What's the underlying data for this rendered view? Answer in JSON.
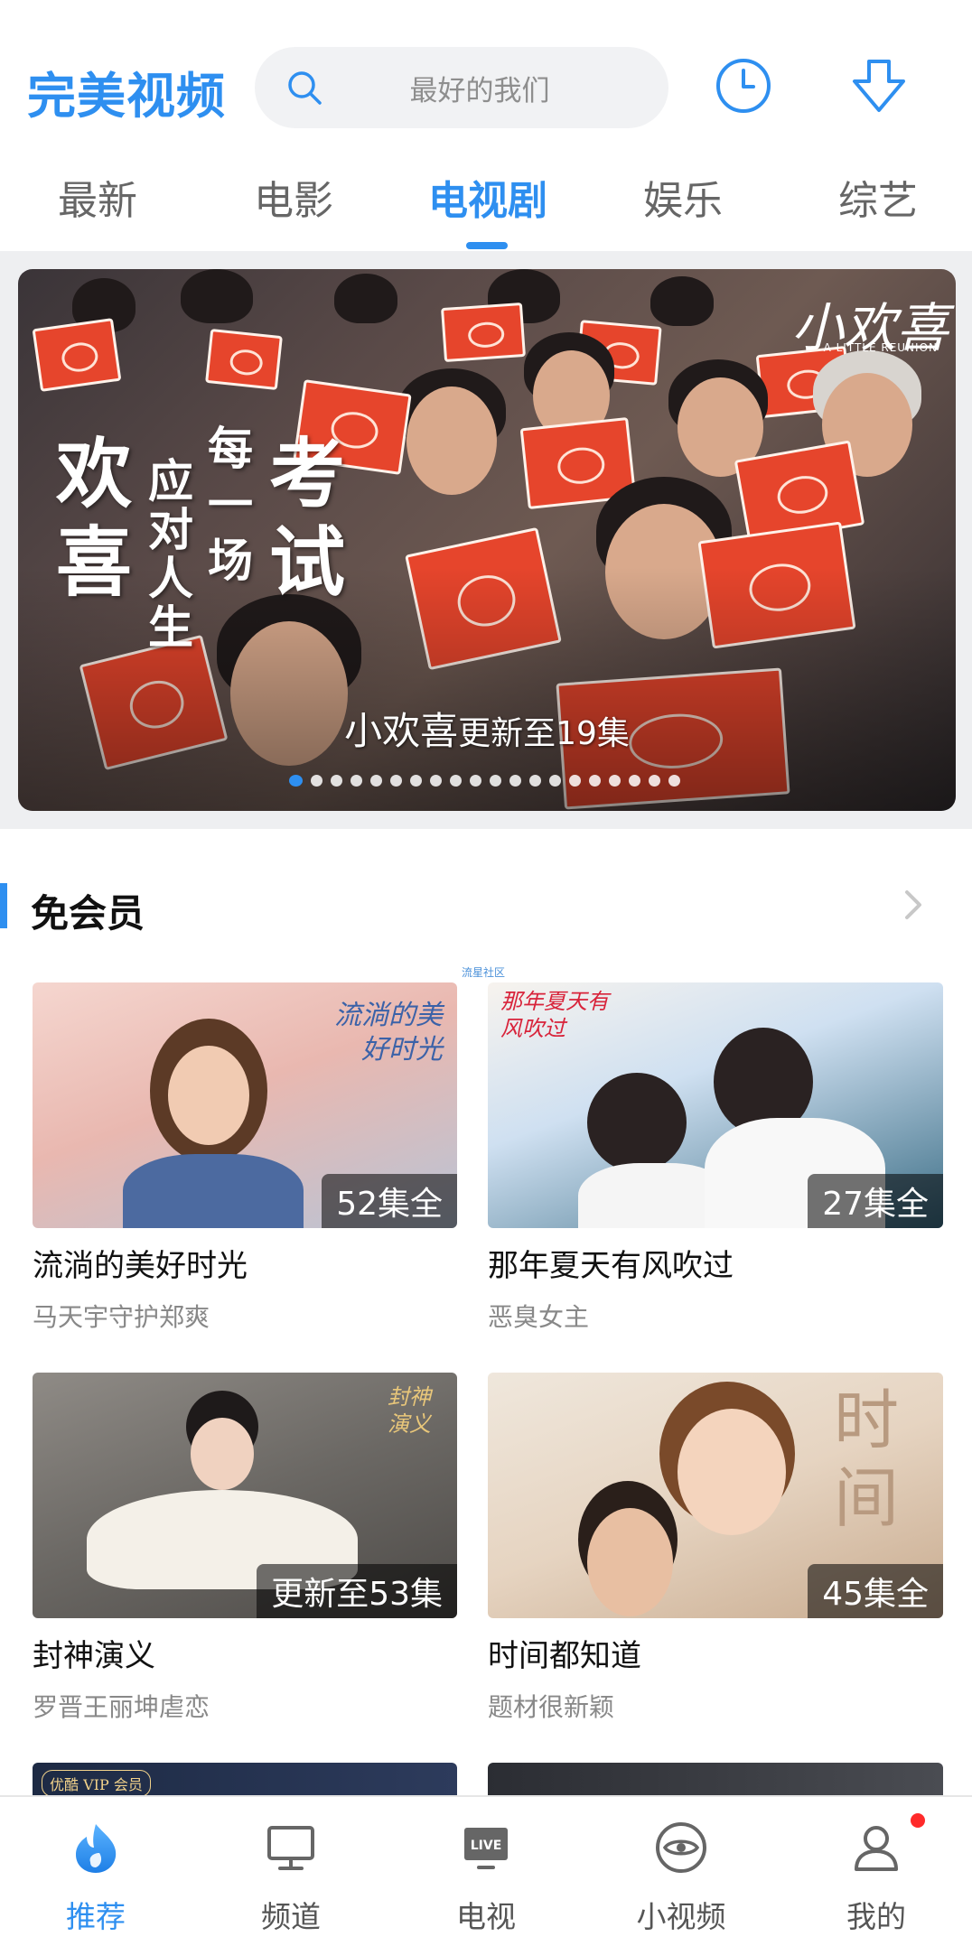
{
  "header": {
    "app_title": "完美视频",
    "search_placeholder": "最好的我们",
    "icons": [
      "search-icon",
      "clock-icon",
      "download-icon"
    ]
  },
  "tabs": [
    {
      "label": "最新"
    },
    {
      "label": "电影"
    },
    {
      "label": "电视剧",
      "active": true
    },
    {
      "label": "娱乐"
    },
    {
      "label": "综艺"
    }
  ],
  "banner": {
    "title": "小欢喜",
    "caption_suffix": "更新至19集",
    "slogan_big_1": "欢",
    "slogan_big_2": "喜",
    "slogan_big_3": "考",
    "slogan_big_4": "试",
    "slogan_col_a": "应对人生",
    "slogan_col_b": "每一场",
    "logo_text": "小欢喜",
    "logo_sub": "A LITTLE REUNION",
    "page_count": 20,
    "active_page": 0
  },
  "section": {
    "title": "免会员",
    "watermark": "流星社区"
  },
  "cards": [
    {
      "title": "流淌的美好时光",
      "subtitle": "马天宇守护郑爽",
      "badge": "52集全",
      "poster_text": "流淌的美好时光"
    },
    {
      "title": "那年夏天有风吹过",
      "subtitle": "恶臭女主",
      "badge": "27集全",
      "poster_text": "那年夏天有风吹过"
    },
    {
      "title": "封神演义",
      "subtitle": "罗晋王丽坤虐恋",
      "badge": "更新至53集",
      "poster_text": "封神演义"
    },
    {
      "title": "时间都知道",
      "subtitle": "题材很新颖",
      "badge": "45集全",
      "poster_text": "时间"
    },
    {
      "title": "",
      "subtitle": "",
      "badge": "",
      "poster_text": "优酷 VIP 会员"
    },
    {
      "title": "",
      "subtitle": "",
      "badge": "",
      "poster_text": ""
    }
  ],
  "bottom_nav": [
    {
      "label": "推荐",
      "icon": "flame-icon",
      "active": true
    },
    {
      "label": "频道",
      "icon": "monitor-icon"
    },
    {
      "label": "电视",
      "icon": "live-tv-icon"
    },
    {
      "label": "小视频",
      "icon": "eye-icon"
    },
    {
      "label": "我的",
      "icon": "user-icon",
      "badge_dot": true
    }
  ],
  "colors": {
    "accent": "#2e8ff0",
    "badge_red": "#ff2a2a",
    "banner_book_red": "#e6452c"
  }
}
